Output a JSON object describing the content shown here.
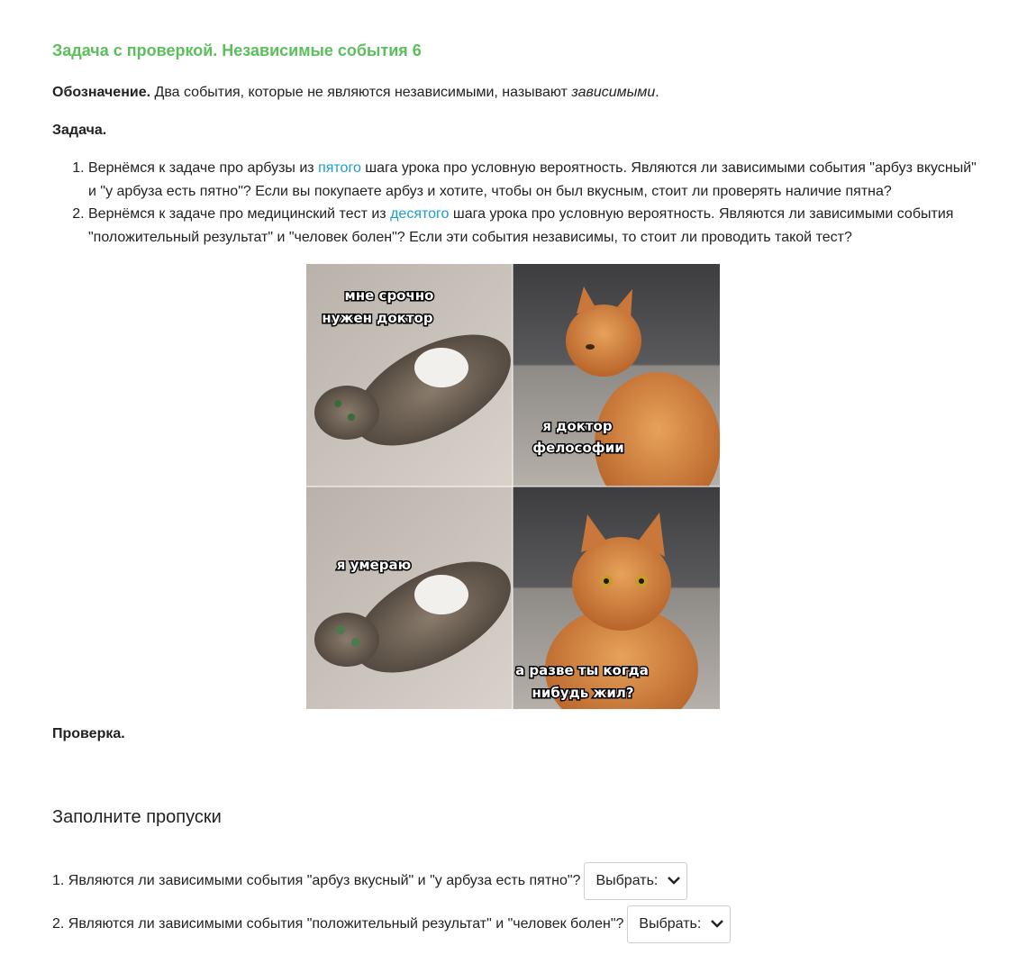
{
  "title": "Задача с проверкой. Независимые события 6",
  "definition": {
    "label": "Обозначение.",
    "text": " Два события, которые не являются независимыми, называют ",
    "term": "зависимыми",
    "end": "."
  },
  "task_heading": "Задача.",
  "tasks": [
    {
      "before": "Вернёмся к задаче про арбузы из ",
      "link": "пятого",
      "after": " шага урока про условную вероятность. Являются ли зависимыми события \"арбуз вкусный\" и \"у арбуза есть пятно\"? Если вы покупаете арбуз и хотите, чтобы он был вкусным, стоит ли проверять наличие пятна?"
    },
    {
      "before": "Вернёмся к задаче про медицинский тест из ",
      "link": "десятого",
      "after": "  шага урока про условную вероятность. Являются ли зависимыми события \"положительный результат\" и \"человек болен\"? Если эти события независимы, то стоит ли проводить такой тест?"
    }
  ],
  "meme": {
    "panel1": [
      "мне срочно",
      "нужен доктор"
    ],
    "panel2": [
      "я доктор",
      "фелософии"
    ],
    "panel3": [
      "я умераю"
    ],
    "panel4": [
      "а разве ты когда",
      "нибудь жил?"
    ]
  },
  "check_heading": "Проверка.",
  "fill_heading": "Заполните пропуски",
  "questions": [
    {
      "text": "1. Являются ли зависимыми события \"арбуз вкусный\" и \"у арбуза есть пятно\"?",
      "select_label": "Выбрать:"
    },
    {
      "text": "2. Являются ли зависимыми события \"положительный результат\" и \"человек болен\"?",
      "select_label": "Выбрать:"
    }
  ],
  "colors": {
    "title": "#5cbf5c",
    "link": "#1a9bd6",
    "text": "#222222"
  }
}
